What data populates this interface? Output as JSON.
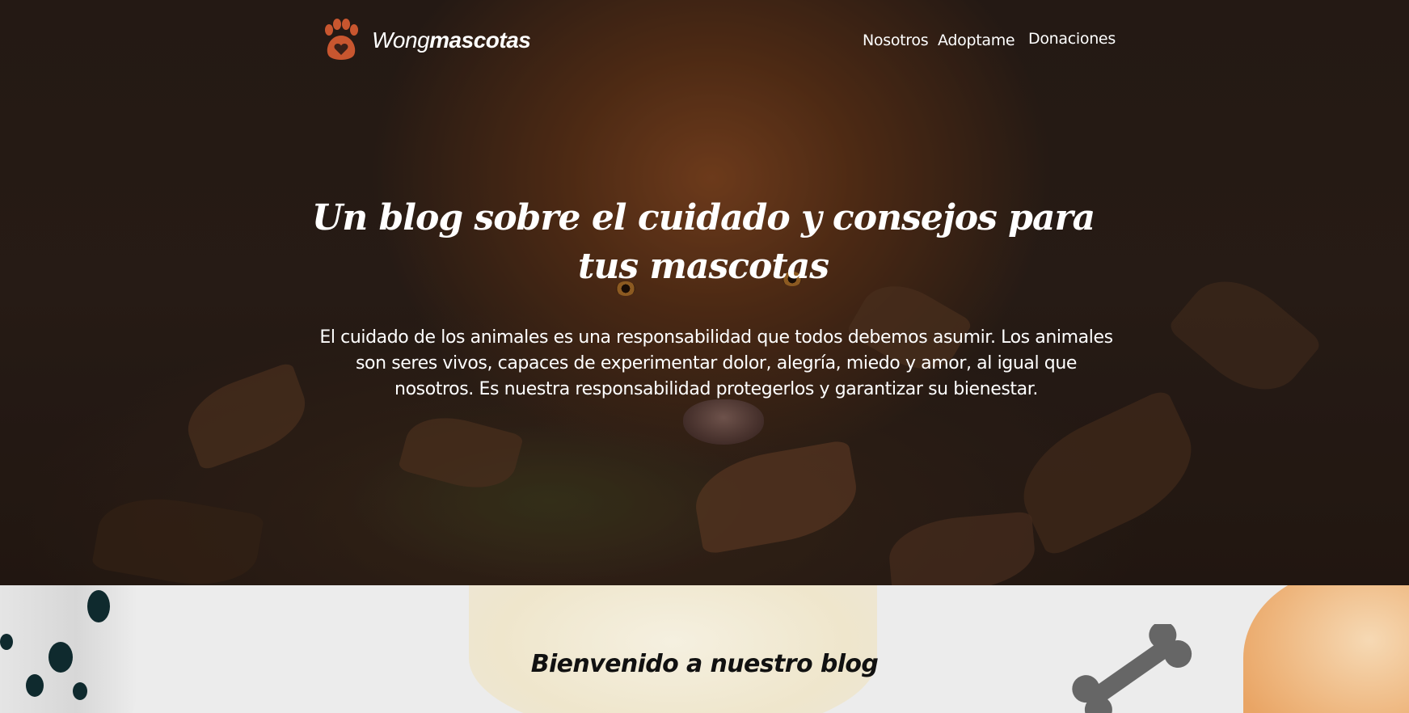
{
  "brand": {
    "name_regular": "Wong",
    "name_bold": "mascotas",
    "accent_color": "#c8562f"
  },
  "nav": {
    "items": [
      {
        "label": "Nosotros"
      },
      {
        "label": "Adoptame"
      },
      {
        "label": "Donaciones"
      }
    ]
  },
  "hero": {
    "title": "Un blog sobre el cuidado y consejos para tus mascotas",
    "description": "El cuidado de los animales es una responsabilidad que todos debemos asumir. Los animales son seres vivos, capaces de experimentar dolor, alegría, miedo y amor, al igual que nosotros. Es nuestra responsabilidad protegerlos y garantizar su bienestar."
  },
  "welcome": {
    "heading": "Bienvenido a nuestro blog"
  },
  "icons": {
    "logo": "paw-heart-icon",
    "decoration": "bone-icon"
  }
}
